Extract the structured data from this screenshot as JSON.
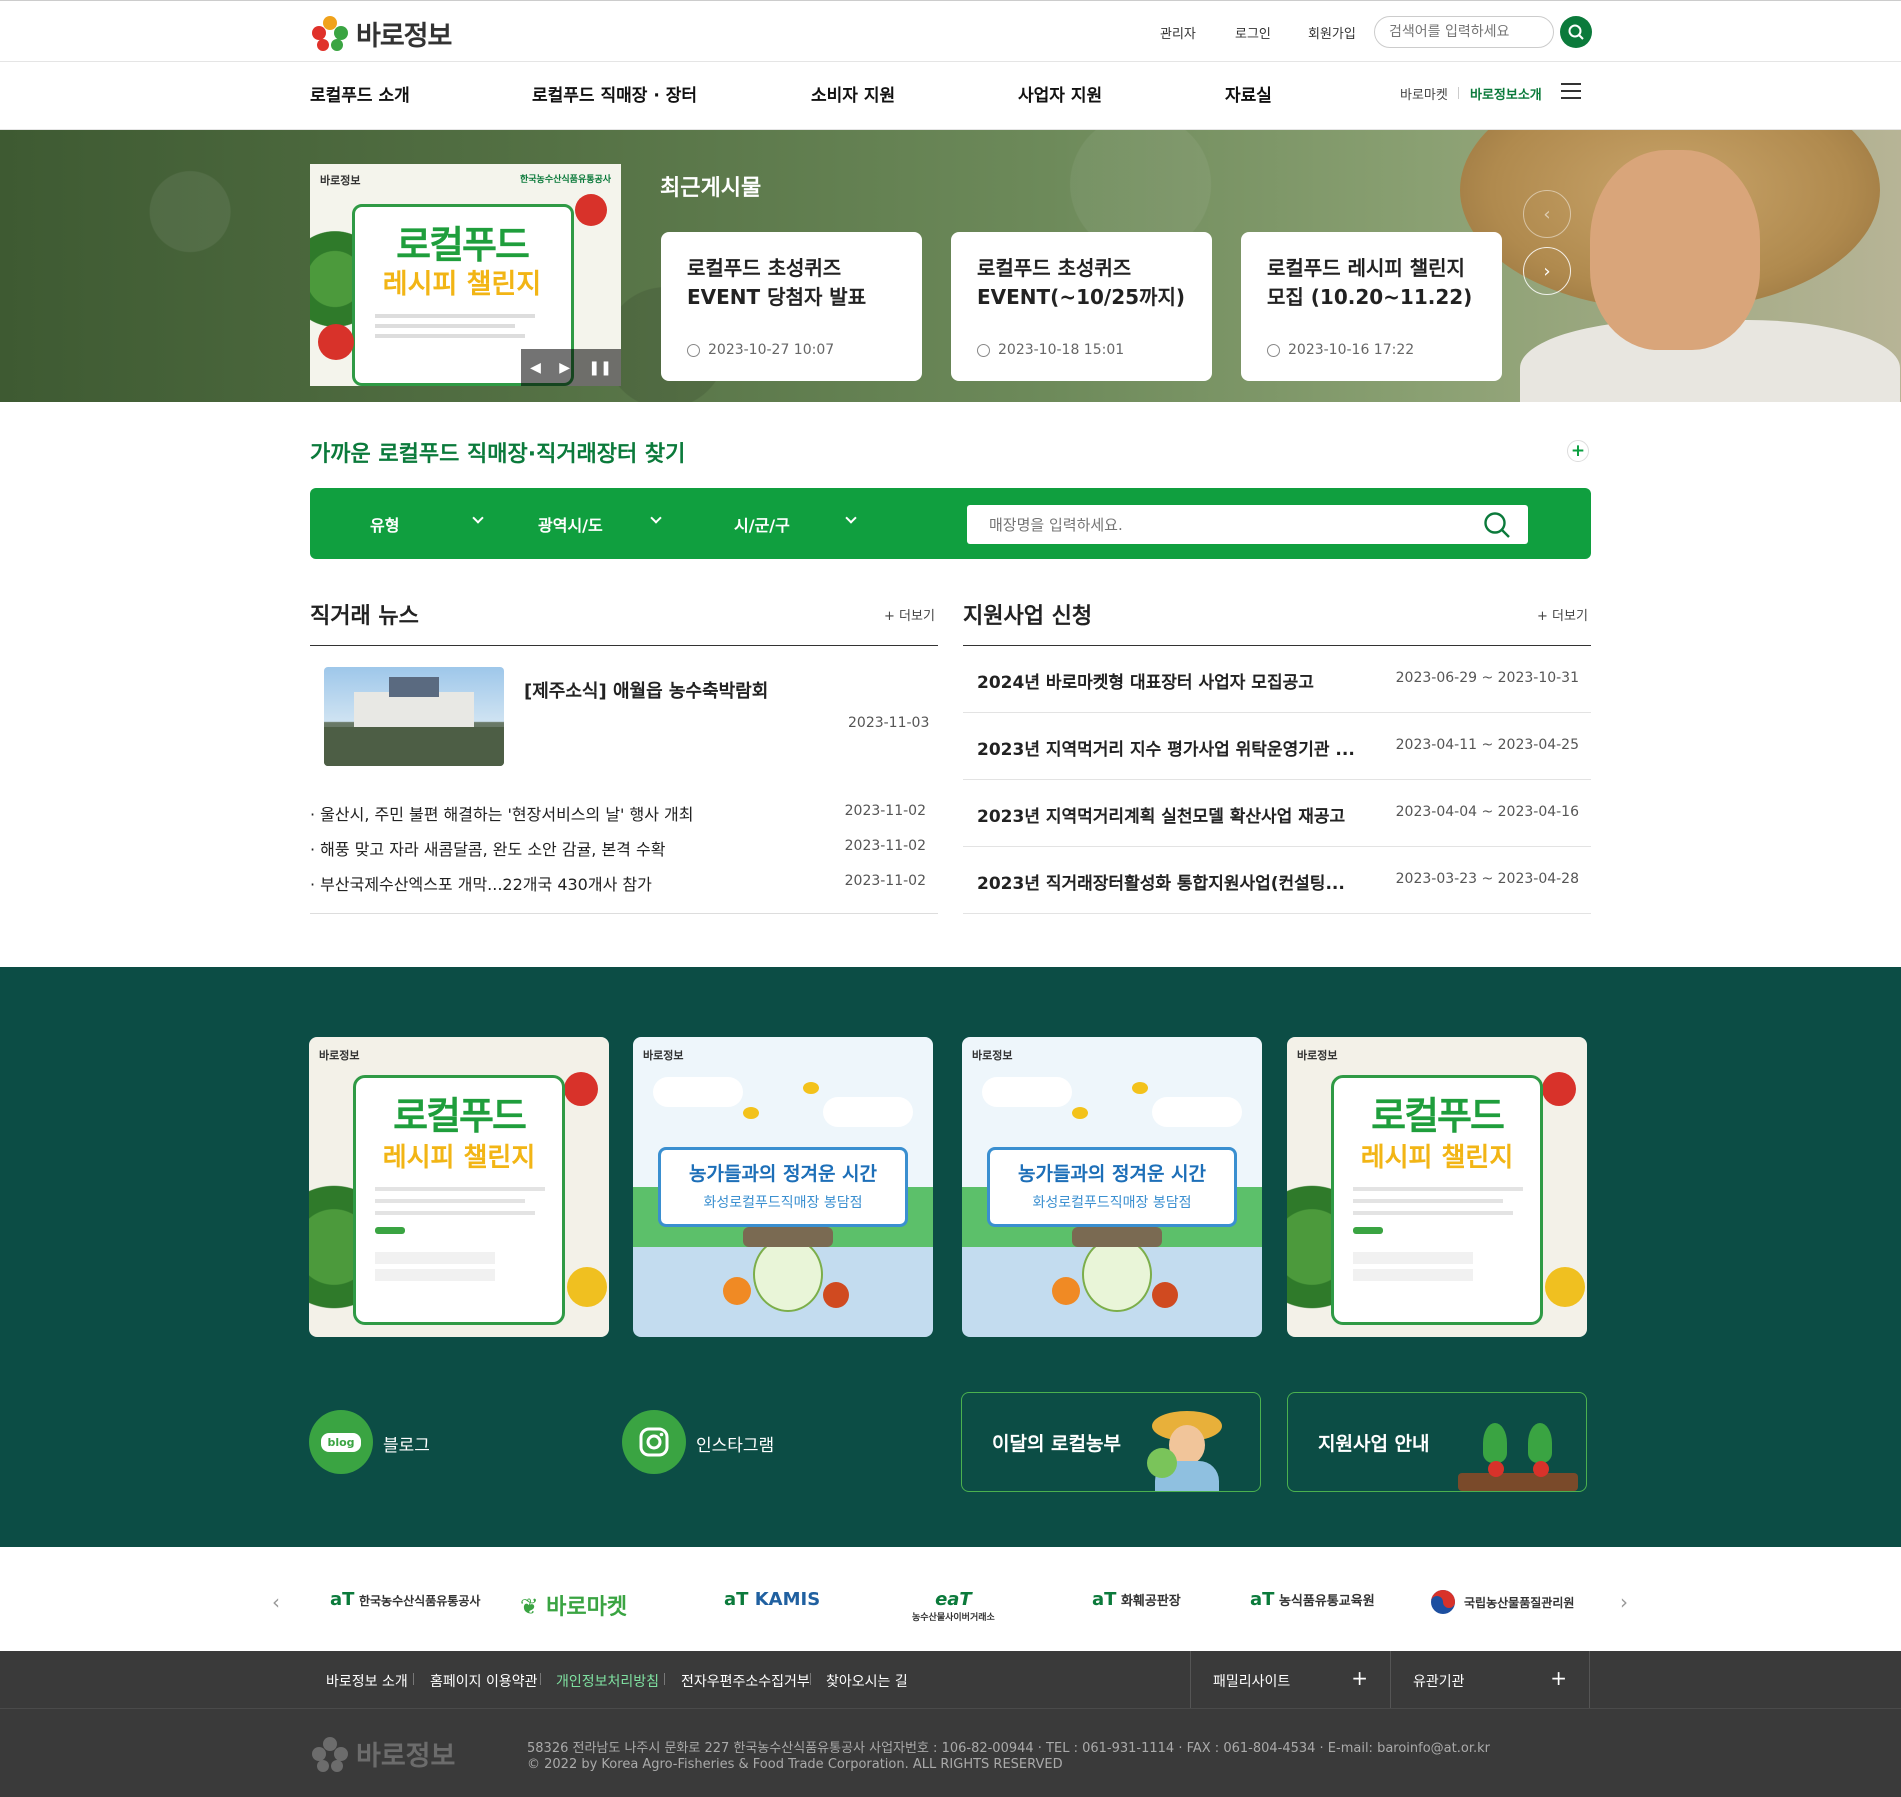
{
  "header": {
    "logo_text": "바로정보",
    "util_links": [
      "관리자",
      "로그인",
      "회원가입"
    ],
    "search_placeholder": "검색어를 입력하세요",
    "gnb": [
      "로컬푸드 소개",
      "로컬푸드 직매장 · 장터",
      "소비자 지원",
      "사업자 지원",
      "자료실"
    ],
    "sub_links": [
      "바로마켓",
      "바로정보소개"
    ],
    "accent": "#0b7a3b"
  },
  "hero": {
    "title": "최근게시물",
    "poster": {
      "brand": "바로정보",
      "org": "한국농수산식품유통공사",
      "headline1": "로컬푸드",
      "headline2": "레시피 챌린지"
    },
    "posts": [
      {
        "title": "로컬푸드 초성퀴즈 EVENT 당첨자 발표",
        "date": "2023-10-27 10:07"
      },
      {
        "title": "로컬푸드 초성퀴즈 EVENT(~10/25까지)",
        "date": "2023-10-18 15:01"
      },
      {
        "title": "로컬푸드 레시피 챌린지 모집 (10.20~11.22)",
        "date": "2023-10-16 17:22"
      }
    ]
  },
  "finder": {
    "title": "가까운 로컬푸드 직매장·직거래장터 찾기",
    "selects": [
      "유형",
      "광역시/도",
      "시/군/구"
    ],
    "store_placeholder": "매장명을 입력하세요.",
    "bar_color": "#109f3f"
  },
  "news": {
    "title": "직거래 뉴스",
    "more": "더보기",
    "featured": {
      "title": "[제주소식] 애월읍 농수축박람회",
      "date": "2023-11-03"
    },
    "items": [
      {
        "title": "울산시, 주민 불편 해결하는 '현장서비스의 날' 행사 개최",
        "date": "2023-11-02"
      },
      {
        "title": "해풍 맞고 자라 새콤달콤, 완도 소안 감귤, 본격 수확",
        "date": "2023-11-02"
      },
      {
        "title": "부산국제수산엑스포 개막...22개국 430개사 참가",
        "date": "2023-11-02"
      }
    ]
  },
  "support": {
    "title": "지원사업 신청",
    "more": "더보기",
    "items": [
      {
        "title": "2024년 바로마켓형 대표장터 사업자 모집공고",
        "date": "2023-06-29 ~ 2023-10-31"
      },
      {
        "title": "2023년 지역먹거리 지수 평가사업 위탁운영기관 ...",
        "date": "2023-04-11 ~ 2023-04-25"
      },
      {
        "title": "2023년 지역먹거리계획 실천모델 확산사업 재공고",
        "date": "2023-04-04 ~ 2023-04-16"
      },
      {
        "title": "2023년 직거래장터활성화 통합지원사업(컨설팅...",
        "date": "2023-03-23 ~ 2023-04-28"
      }
    ]
  },
  "banners": {
    "cards": [
      {
        "type": "recipe",
        "brand": "바로정보",
        "h1": "로컬푸드",
        "h2": "레시피 챌린지"
      },
      {
        "type": "farm",
        "brand": "바로정보",
        "h1": "농가들과의 정겨운 시간",
        "h2": "화성로컬푸드직매장 봉담점"
      },
      {
        "type": "farm",
        "brand": "바로정보",
        "h1": "농가들과의 정겨운 시간",
        "h2": "화성로컬푸드직매장 봉담점"
      },
      {
        "type": "recipe",
        "brand": "바로정보",
        "h1": "로컬푸드",
        "h2": "레시피 챌린지"
      }
    ],
    "sns": [
      {
        "label": "블로그",
        "icon_text": "blog"
      },
      {
        "label": "인스타그램"
      }
    ],
    "promos": [
      "이달의 로컬농부",
      "지원사업 안내"
    ],
    "bg_color": "#0c4d45"
  },
  "partners": [
    {
      "name": "한국농수산식품유통공사",
      "mark": "aT"
    },
    {
      "name": "바로마켓"
    },
    {
      "name": "KAMIS",
      "mark": "aT"
    },
    {
      "name": "농수산물사이버거래소",
      "mark": "eaT"
    },
    {
      "name": "화훼공판장",
      "mark": "aT"
    },
    {
      "name": "농식품유통교육원",
      "mark": "aT"
    },
    {
      "name": "국립농산물품질관리원"
    }
  ],
  "footer": {
    "links": [
      "바로정보 소개",
      "홈페이지 이용약관",
      "개인정보처리방침",
      "전자우편주소수집거부",
      "찾아오시는 길"
    ],
    "highlight_color": "#7fe0a0",
    "family": [
      "패밀리사이트",
      "유관기관"
    ],
    "logo_text": "바로정보",
    "address": "58326 전라남도 나주시 문화로 227 한국농수산식품유통공사 사업자번호 : 106-82-00944 · TEL : 061-931-1114 · FAX : 061-804-4534 · E-mail: baroinfo@at.or.kr",
    "copyright": "© 2022 by Korea Agro-Fisheries & Food Trade Corporation. ALL RIGHTS RESERVED"
  }
}
